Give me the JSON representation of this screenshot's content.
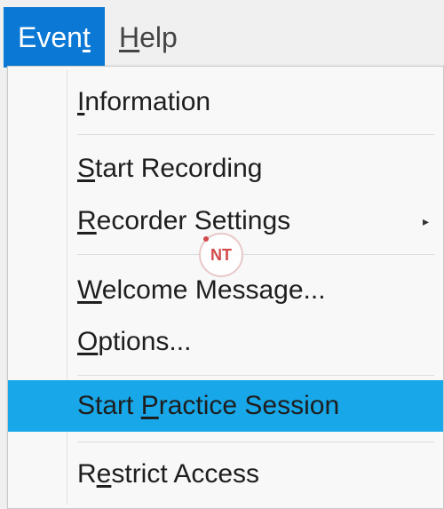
{
  "menubar": {
    "event": {
      "label": "Event",
      "pre": "Even",
      "key": "t",
      "post": ""
    },
    "help": {
      "label": "Help",
      "pre": "",
      "key": "H",
      "post": "elp"
    }
  },
  "menu": {
    "items": [
      {
        "label": "Information",
        "pre": "",
        "key": "I",
        "post": "nformation"
      },
      {
        "label": "Start Recording",
        "pre": "",
        "key": "S",
        "post": "tart Recording"
      },
      {
        "label": "Recorder Settings",
        "pre": "",
        "key": "R",
        "post": "ecorder Settings",
        "submenu_icon": "chevron-right-icon"
      },
      {
        "label": "Welcome Message...",
        "pre": "",
        "key": "W",
        "post": "elcome Message..."
      },
      {
        "label": "Options...",
        "pre": "",
        "key": "O",
        "post": "ptions..."
      },
      {
        "label": "Start Practice Session",
        "pre": "Start ",
        "key": "P",
        "post": "ractice Session",
        "highlighted": true
      },
      {
        "label": "Restrict Access",
        "pre": "R",
        "key": "e",
        "post": "strict Access"
      }
    ]
  },
  "watermark": {
    "text": "NT",
    "icon": "nt-logo-icon"
  },
  "colors": {
    "menubar_active": "#0a78d4",
    "highlight": "#18a7e8",
    "menu_bg": "#f8f8f8"
  }
}
